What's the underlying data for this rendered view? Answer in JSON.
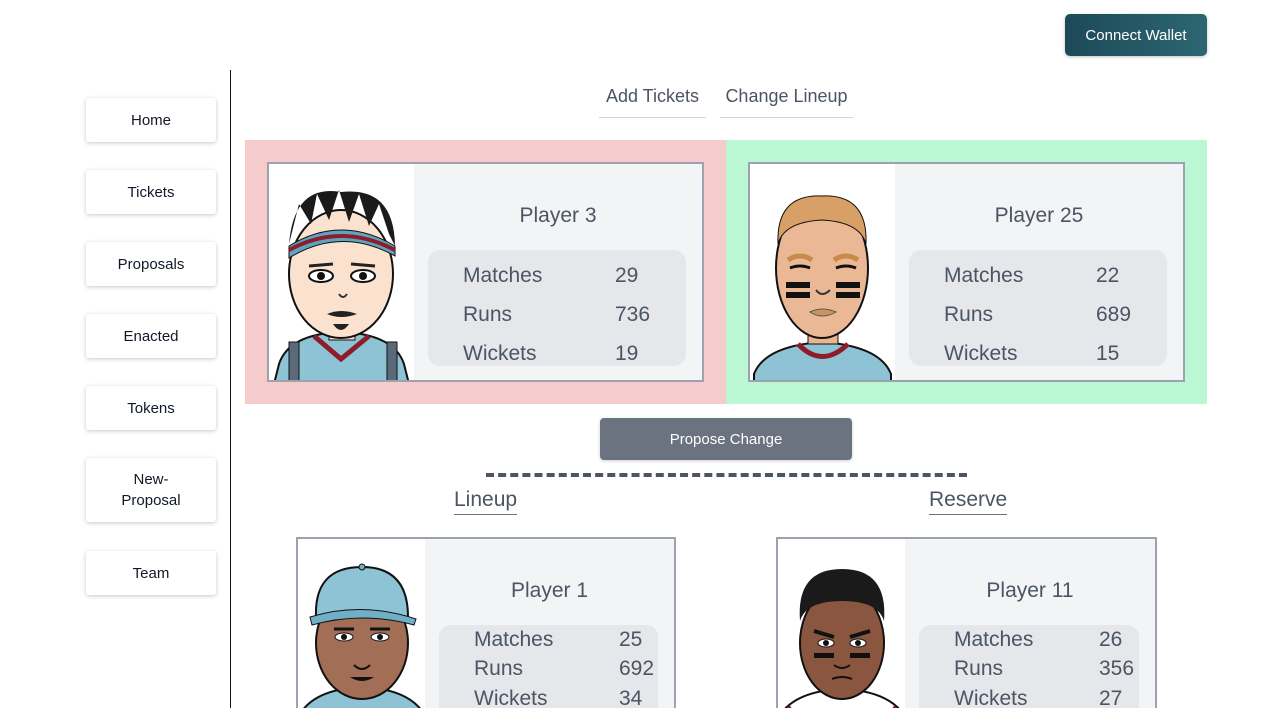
{
  "header": {
    "connect_wallet_label": "Connect Wallet"
  },
  "sidebar": {
    "items": [
      {
        "label": "Home"
      },
      {
        "label": "Tickets"
      },
      {
        "label": "Proposals"
      },
      {
        "label": "Enacted"
      },
      {
        "label": "Tokens"
      },
      {
        "label": "New-\nProposal"
      },
      {
        "label": "Team"
      }
    ]
  },
  "tabs": [
    {
      "label": "Add Tickets"
    },
    {
      "label": "Change Lineup"
    }
  ],
  "swap": {
    "out_player": {
      "name": "Player 3",
      "stats": [
        {
          "label": "Matches",
          "value": "29"
        },
        {
          "label": "Runs",
          "value": "736"
        },
        {
          "label": "Wickets",
          "value": "19"
        }
      ]
    },
    "in_player": {
      "name": "Player 25",
      "stats": [
        {
          "label": "Matches",
          "value": "22"
        },
        {
          "label": "Runs",
          "value": "689"
        },
        {
          "label": "Wickets",
          "value": "15"
        }
      ]
    },
    "out_color": "#f6cbcb",
    "in_color": "#bbf7d2"
  },
  "propose_label": "Propose Change",
  "sections": {
    "lineup_title": "Lineup",
    "reserve_title": "Reserve"
  },
  "lineup": [
    {
      "name": "Player 1",
      "stats": [
        {
          "label": "Matches",
          "value": "25"
        },
        {
          "label": "Runs",
          "value": "692"
        },
        {
          "label": "Wickets",
          "value": "34"
        }
      ]
    }
  ],
  "reserve": [
    {
      "name": "Player 11",
      "stats": [
        {
          "label": "Matches",
          "value": "26"
        },
        {
          "label": "Runs",
          "value": "356"
        },
        {
          "label": "Wickets",
          "value": "27"
        }
      ]
    }
  ]
}
